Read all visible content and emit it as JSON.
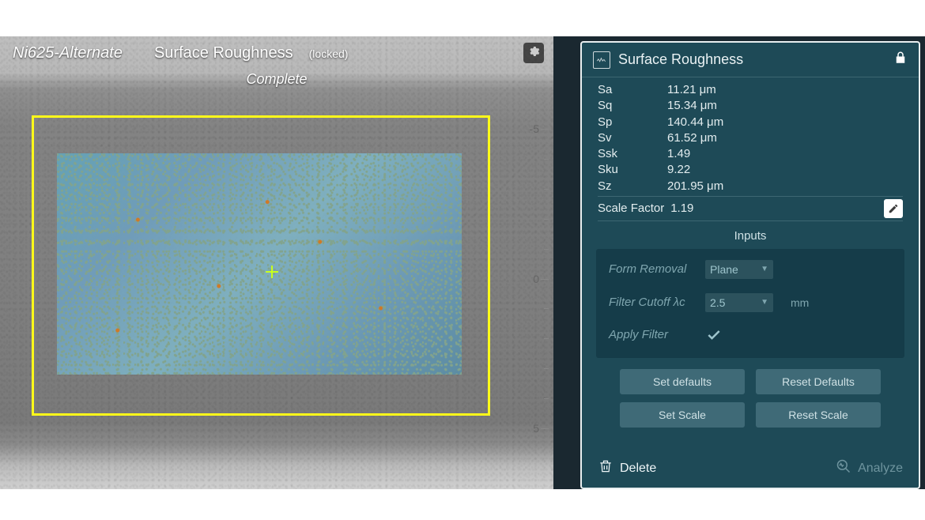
{
  "viewport": {
    "sample_name": "Ni625-Alternate",
    "mode_title": "Surface Roughness",
    "lock_tag": "(locked)",
    "status": "Complete",
    "scale_ticks": {
      "neg5": "-5",
      "zero": "0",
      "pos5": "5"
    }
  },
  "panel": {
    "title": "Surface Roughness",
    "metrics": [
      {
        "k": "Sa",
        "v": "11.21 μm"
      },
      {
        "k": "Sq",
        "v": "15.34 μm"
      },
      {
        "k": "Sp",
        "v": "140.44 μm"
      },
      {
        "k": "Sv",
        "v": "61.52 μm"
      },
      {
        "k": "Ssk",
        "v": "1.49"
      },
      {
        "k": "Sku",
        "v": "9.22"
      },
      {
        "k": "Sz",
        "v": "201.95 μm"
      }
    ],
    "scale_factor_label": "Scale Factor",
    "scale_factor_value": "1.19",
    "inputs_heading": "Inputs",
    "form_removal_label": "Form Removal",
    "form_removal_value": "Plane",
    "filter_cutoff_label": "Filter Cutoff λc",
    "filter_cutoff_value": "2.5",
    "filter_cutoff_unit": "mm",
    "apply_filter_label": "Apply Filter",
    "buttons": {
      "set_defaults": "Set defaults",
      "reset_defaults": "Reset Defaults",
      "set_scale": "Set Scale",
      "reset_scale": "Reset Scale"
    },
    "footer": {
      "delete": "Delete",
      "analyze": "Analyze"
    }
  }
}
